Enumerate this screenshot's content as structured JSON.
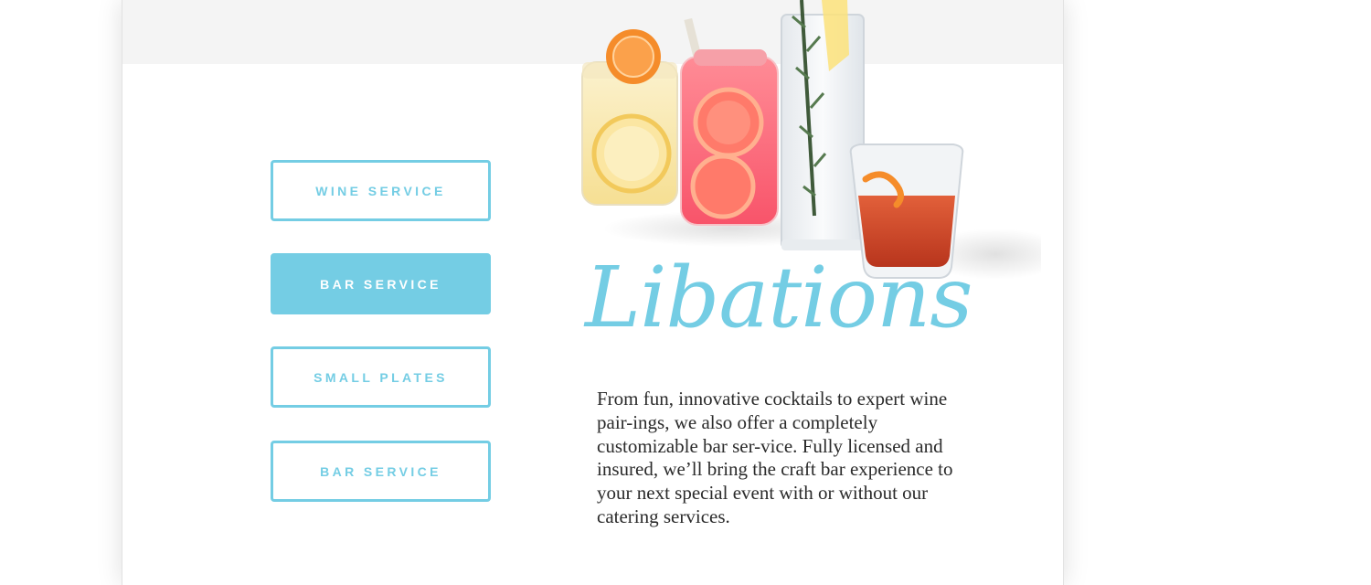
{
  "nav": {
    "buttons": [
      {
        "label": "WINE SERVICE",
        "active": false
      },
      {
        "label": "BAR SERVICE",
        "active": true
      },
      {
        "label": "SMALL PLATES",
        "active": false
      },
      {
        "label": "BAR SERVICE",
        "active": false
      }
    ]
  },
  "section": {
    "title": "Libations",
    "body": "From fun, innovative cocktails to expert wine pair-ings, we also offer a completely customizable bar ser-vice. Fully licensed and insured, we’ll bring the craft bar experience to your next special event with or without our catering services."
  },
  "colors": {
    "accent": "#74cde4",
    "band": "#f4f4f4",
    "text": "#2b2b2b"
  }
}
